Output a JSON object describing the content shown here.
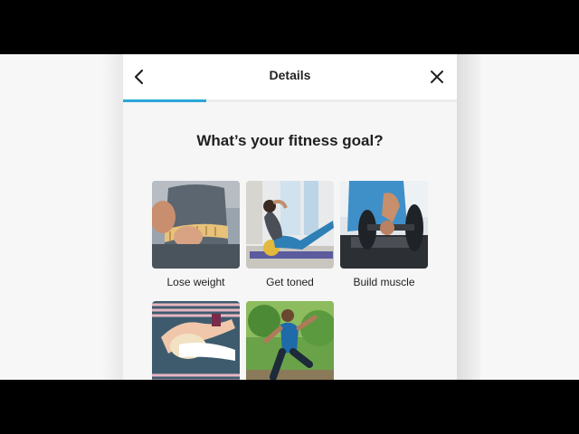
{
  "header": {
    "title": "Details",
    "back_icon": "chevron-left-icon",
    "close_icon": "close-icon"
  },
  "progress": {
    "fraction": 0.25,
    "color": "#2aa7d6"
  },
  "question": "What’s your fitness goal?",
  "goals": [
    {
      "label": "Lose weight"
    },
    {
      "label": "Get toned"
    },
    {
      "label": "Build muscle"
    },
    {
      "label": ""
    },
    {
      "label": ""
    }
  ]
}
